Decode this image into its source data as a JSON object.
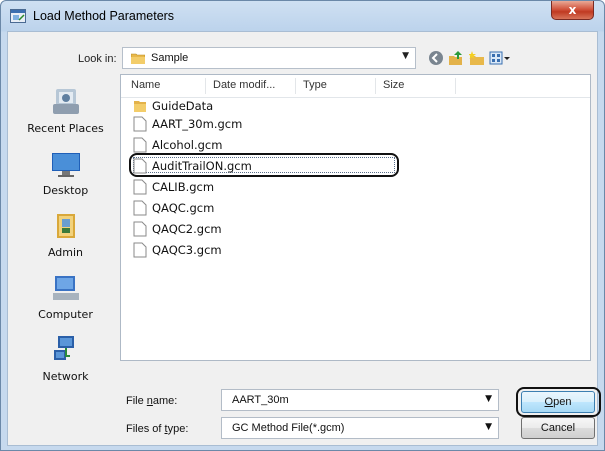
{
  "window": {
    "title": "Load Method Parameters",
    "close_label": "x"
  },
  "look_in": {
    "label": "Look in:",
    "value": "Sample"
  },
  "places": [
    {
      "label": "Recent Places",
      "icon": "recent-places-icon"
    },
    {
      "label": "Desktop",
      "icon": "desktop-icon"
    },
    {
      "label": "Admin",
      "icon": "user-folder-icon"
    },
    {
      "label": "Computer",
      "icon": "computer-icon"
    },
    {
      "label": "Network",
      "icon": "network-icon"
    }
  ],
  "columns": [
    "Name",
    "Date modif...",
    "Type",
    "Size"
  ],
  "files": [
    {
      "name": "GuideData",
      "kind": "folder"
    },
    {
      "name": "AART_30m.gcm",
      "kind": "file",
      "selected": true
    },
    {
      "name": "Alcohol.gcm",
      "kind": "file"
    },
    {
      "name": "AuditTrailON.gcm",
      "kind": "file"
    },
    {
      "name": "CALIB.gcm",
      "kind": "file"
    },
    {
      "name": "QAQC.gcm",
      "kind": "file"
    },
    {
      "name": "QAQC2.gcm",
      "kind": "file"
    },
    {
      "name": "QAQC3.gcm",
      "kind": "file"
    }
  ],
  "file_name": {
    "label_pre": "File ",
    "label_u": "n",
    "label_post": "ame:",
    "value": "AART_30m"
  },
  "file_type": {
    "label_pre": "Files of ",
    "label_u": "t",
    "label_post": "ype:",
    "value": "GC Method File(*.gcm)"
  },
  "buttons": {
    "open_pre": "",
    "open_u": "O",
    "open_post": "pen",
    "cancel": "Cancel"
  }
}
